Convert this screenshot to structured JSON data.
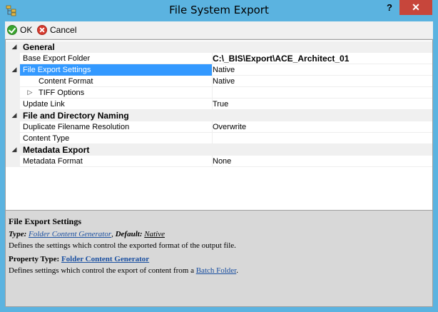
{
  "window": {
    "title": "File System Export",
    "help_label": "?",
    "close_label": "✕"
  },
  "toolbar": {
    "ok_label": "OK",
    "cancel_label": "Cancel"
  },
  "grid": {
    "general": "General",
    "base_export_folder": {
      "name": "Base Export Folder",
      "value": "C:\\_BIS\\Export\\ACE_Architect_01"
    },
    "file_export_settings": {
      "name": "File Export Settings",
      "value": "Native"
    },
    "content_format": {
      "name": "Content Format",
      "value": "Native"
    },
    "tiff_options": {
      "name": "TIFF Options",
      "value": ""
    },
    "update_link": {
      "name": "Update Link",
      "value": "True"
    },
    "file_dir_naming": "File and Directory Naming",
    "dup_filename": {
      "name": "Duplicate Filename Resolution",
      "value": "Overwrite"
    },
    "content_type": {
      "name": "Content Type",
      "value": ""
    },
    "metadata_export": "Metadata Export",
    "metadata_format": {
      "name": "Metadata Format",
      "value": "None"
    },
    "expanded_glyph": "◢",
    "collapsed_glyph": "▷"
  },
  "description": {
    "title": "File Export Settings",
    "type_label": "Type:",
    "type_value": "Folder Content Generator",
    "default_label": "Default:",
    "default_value": "Native",
    "comma": ",",
    "settings_text": "Defines the settings which control the exported format of the output file.",
    "property_type_label": "Property Type:",
    "property_type_value": "Folder Content Generator",
    "defines_text": "Defines settings which control the export of content from a",
    "batch_folder": "Batch Folder",
    "period": "."
  }
}
